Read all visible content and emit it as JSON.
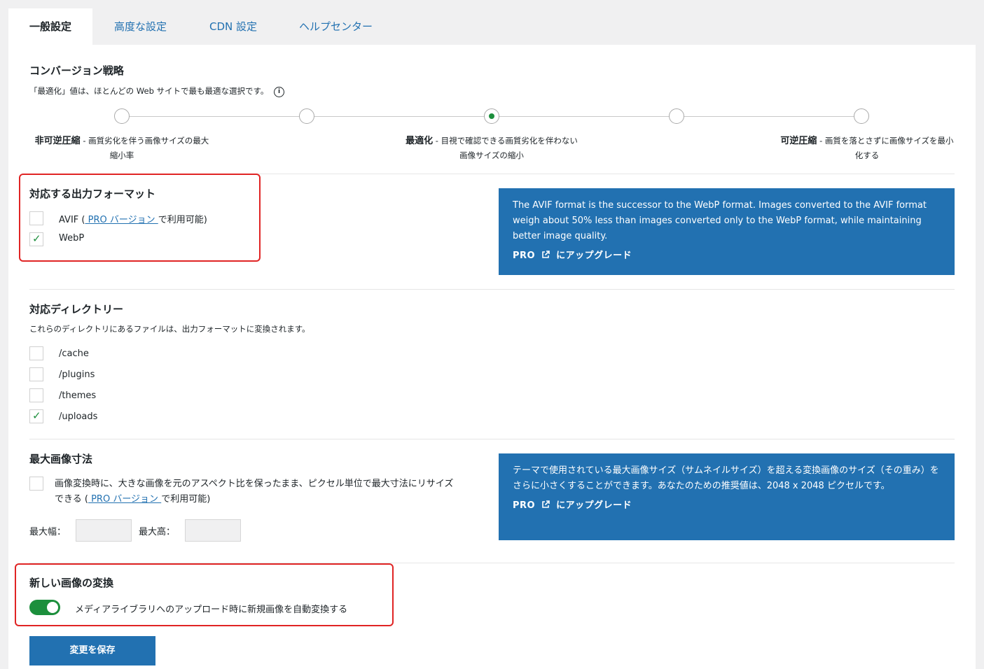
{
  "tabs": [
    {
      "label": "一般設定",
      "active": true
    },
    {
      "label": "高度な設定"
    },
    {
      "label": "CDN 設定"
    },
    {
      "label": "ヘルプセンター"
    }
  ],
  "conversion": {
    "title": "コンバージョン戦略",
    "desc": "「最適化」値は、ほとんどの Web サイトで最も最適な選択です。",
    "info_icon": "info-icon",
    "selected_stop": 3,
    "stops": [
      {
        "name": "非可逆圧縮",
        "desc": " - 画質劣化を伴う画像サイズの最大",
        "desc2": "縮小率"
      },
      {
        "name": "最適化",
        "desc": " - 目視で確認できる画質劣化を伴わない",
        "desc2": "画像サイズの縮小"
      },
      {
        "name": "可逆圧縮",
        "desc": " - 画質を落とさずに画像サイズを最小",
        "desc2": "化する"
      }
    ]
  },
  "formats": {
    "title": "対応する出力フォーマット",
    "avif_label": "AVIF (",
    "avif_link": " PRO バージョン ",
    "avif_suffix": "で利用可能)",
    "avif_checked": false,
    "webp_label": "WebP",
    "webp_checked": true
  },
  "avif_info": {
    "text": "The AVIF format is the successor to the WebP format. Images converted to the AVIF format weigh about 50% less than images converted only to the WebP format, while maintaining better image quality.",
    "upgrade_pro": "PRO",
    "upgrade_text": "にアップグレード"
  },
  "directories": {
    "title": "対応ディレクトリー",
    "desc": "これらのディレクトリにあるファイルは、出力フォーマットに変換されます。",
    "items": [
      {
        "label": "/cache",
        "checked": false
      },
      {
        "label": "/plugins",
        "checked": false
      },
      {
        "label": "/themes",
        "checked": false
      },
      {
        "label": "/uploads",
        "checked": true
      }
    ]
  },
  "max_size": {
    "title": "最大画像寸法",
    "line1": "画像変換時に、大きな画像を元のアスペクト比を保ったまま、ピクセル単位で最大寸法にリサイズ",
    "line2_pre": "できる (",
    "line2_link": " PRO バージョン ",
    "line2_post": "で利用可能)",
    "width_label": "最大幅：",
    "height_label": "最大高：",
    "width_value": "",
    "height_value": ""
  },
  "size_info": {
    "text": "テーマで使用されている最大画像サイズ（サムネイルサイズ）を超える変換画像のサイズ（その重み）をさらに小さくすることができます。あなたのための推奨値は、2048 x 2048 ピクセルです。",
    "upgrade_pro": "PRO",
    "upgrade_text": "にアップグレード"
  },
  "new_images": {
    "title": "新しい画像の変換",
    "toggle_label": "メディアライブラリへのアップロード時に新規画像を自動変換する",
    "toggle_on": true
  },
  "save_label": "変更を保存",
  "colors": {
    "accent": "#2271b1",
    "green": "#1c8f3c",
    "highlight": "#e02424"
  }
}
